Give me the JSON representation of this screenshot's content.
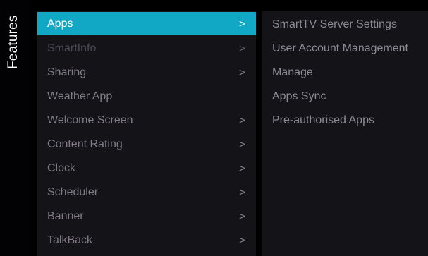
{
  "sidebar": {
    "title": "Features"
  },
  "menu": {
    "items": [
      {
        "label": "Apps",
        "chevron": ">"
      },
      {
        "label": "SmartInfo",
        "chevron": ">"
      },
      {
        "label": "Sharing",
        "chevron": ">"
      },
      {
        "label": "Weather App",
        "chevron": ""
      },
      {
        "label": "Welcome Screen",
        "chevron": ">"
      },
      {
        "label": "Content Rating",
        "chevron": ">"
      },
      {
        "label": "Clock",
        "chevron": ">"
      },
      {
        "label": "Scheduler",
        "chevron": ">"
      },
      {
        "label": "Banner",
        "chevron": ">"
      },
      {
        "label": "TalkBack",
        "chevron": ">"
      }
    ]
  },
  "submenu": {
    "items": [
      {
        "label": "SmartTV Server Settings"
      },
      {
        "label": "User Account Management"
      },
      {
        "label": "Manage"
      },
      {
        "label": "Apps Sync"
      },
      {
        "label": "Pre-authorised Apps"
      }
    ]
  },
  "colors": {
    "accent": "#10a8c4",
    "panel": "#141318",
    "background": "#000000"
  }
}
